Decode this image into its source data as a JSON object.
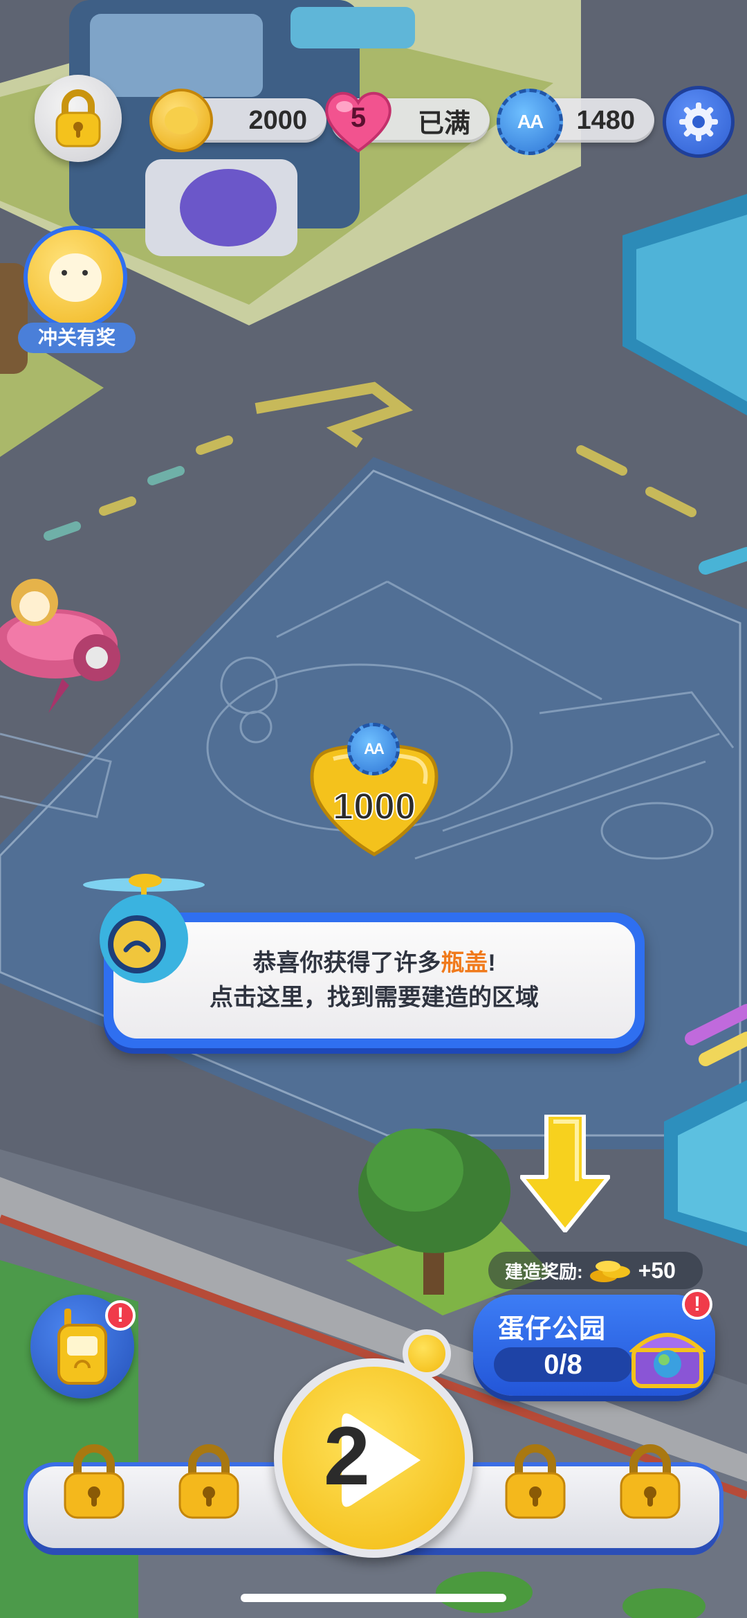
{
  "hud": {
    "coins": "2000",
    "lives": "5",
    "lives_status": "已满",
    "caps": "1480",
    "caps_logo": "AA"
  },
  "side": {
    "reward_label": "冲关有奖"
  },
  "map": {
    "cost_logo": "AA",
    "cost_value": "1000"
  },
  "dialog": {
    "line1_prefix": "恭喜你获得了许多",
    "line1_highlight": "瓶盖",
    "line1_suffix": "!",
    "line2": "点击这里，找到需要建造的区域"
  },
  "build": {
    "reward_label": "建造奖励:",
    "reward_value": "+50",
    "park_name": "蛋仔公园",
    "park_progress": "0/8",
    "badge": "!"
  },
  "bottom": {
    "level_number": "2",
    "walkie_badge": "!"
  },
  "colors": {
    "accent_blue": "#2f6ff0",
    "highlight_orange": "#f07a1c",
    "gold": "#f4c21c",
    "badge_red": "#f03b4a"
  },
  "icons": [
    "lock-icon",
    "coin-icon",
    "heart-icon",
    "bottle-cap-icon",
    "gear-icon",
    "play-icon",
    "walkie-talkie-icon",
    "treasure-chest-icon",
    "arrow-down-icon",
    "helicopter-mascot-icon"
  ]
}
